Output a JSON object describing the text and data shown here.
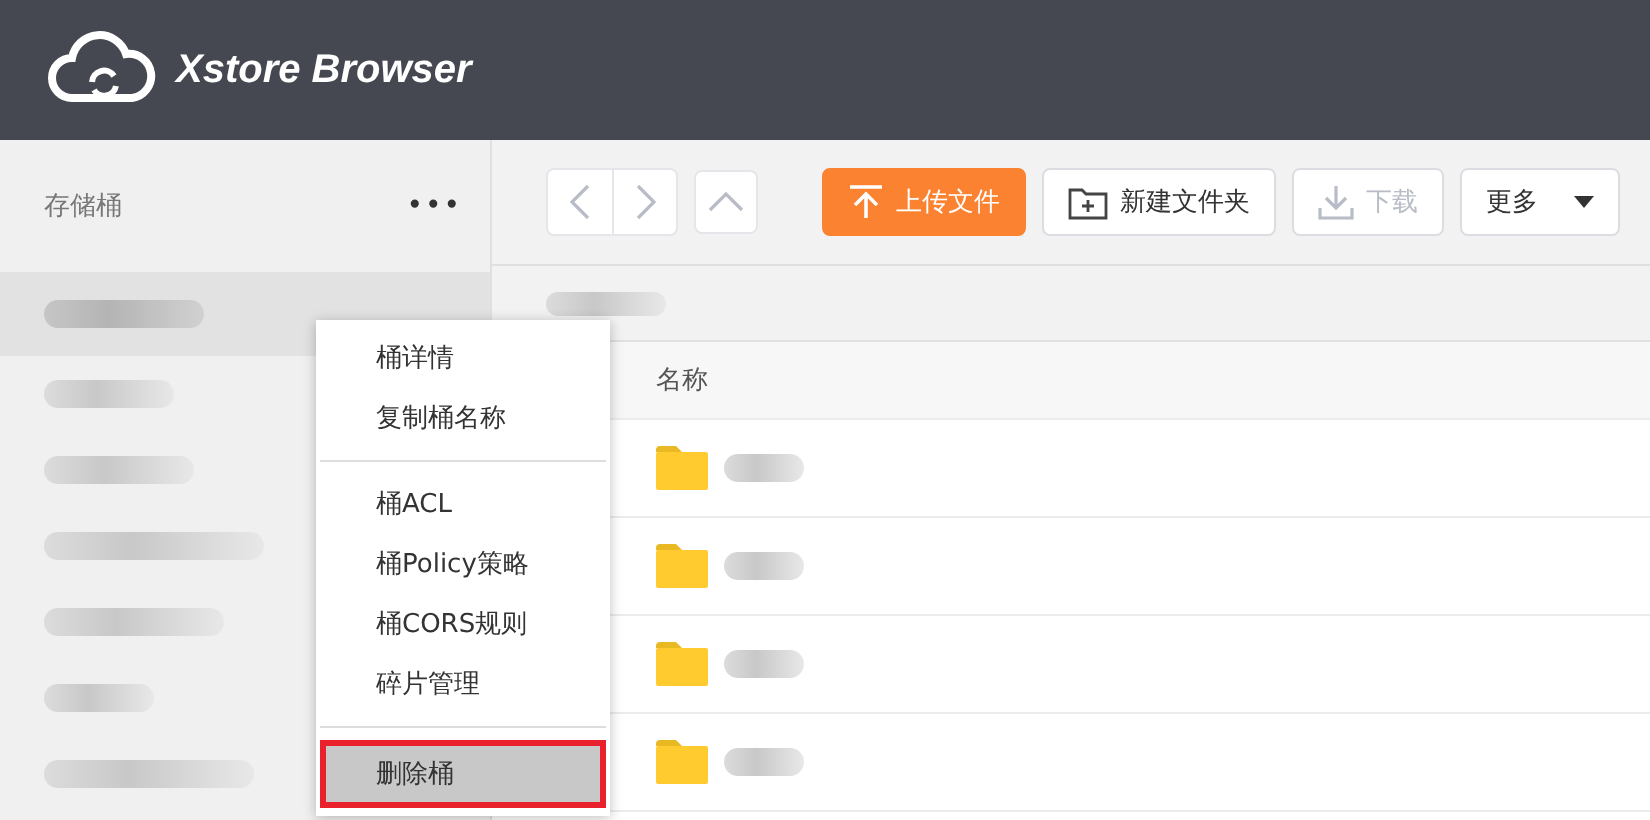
{
  "header": {
    "title": "Xstore Browser"
  },
  "sidebar": {
    "title": "存储桶",
    "more": "•••",
    "buckets": [
      {
        "selected": true
      },
      {
        "selected": false
      },
      {
        "selected": false
      },
      {
        "selected": false
      },
      {
        "selected": false
      },
      {
        "selected": false
      },
      {
        "selected": false
      }
    ]
  },
  "toolbar": {
    "buttons": [
      {
        "kind": "back",
        "disabled": true
      },
      {
        "kind": "forward",
        "disabled": true
      },
      {
        "kind": "up",
        "disabled": true
      },
      {
        "kind": "upload",
        "label": "上传文件",
        "disabled": false
      },
      {
        "kind": "new-folder",
        "label": "新建文件夹",
        "disabled": false
      },
      {
        "kind": "download",
        "label": "下载",
        "disabled": true
      },
      {
        "kind": "more",
        "label": "更多",
        "disabled": false
      }
    ]
  },
  "table": {
    "columns": [
      "名称"
    ],
    "rows": [
      {
        "kind": "folder"
      },
      {
        "kind": "folder"
      },
      {
        "kind": "folder"
      },
      {
        "kind": "folder"
      }
    ]
  },
  "context_menu": {
    "groups": [
      [
        {
          "label": "桶详情",
          "highlighted": false
        },
        {
          "label": "复制桶名称",
          "highlighted": false
        }
      ],
      [
        {
          "label": "桶ACL",
          "highlighted": false
        },
        {
          "label": "桶Policy策略",
          "highlighted": false
        },
        {
          "label": "桶CORS规则",
          "highlighted": false
        },
        {
          "label": "碎片管理",
          "highlighted": false
        }
      ],
      [
        {
          "label": "删除桶",
          "highlighted": true
        }
      ]
    ]
  }
}
